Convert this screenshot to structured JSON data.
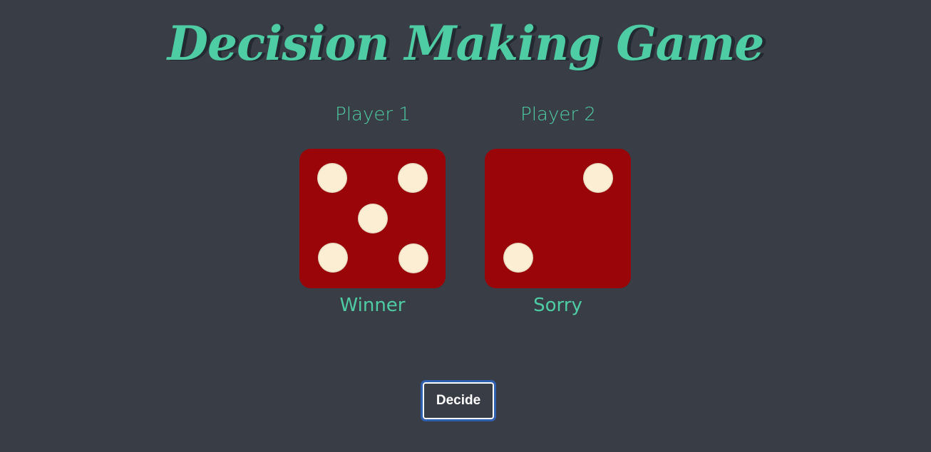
{
  "title": "Decision Making Game",
  "players": [
    {
      "name": "Player 1",
      "die_value": 5,
      "result": "Winner"
    },
    {
      "name": "Player 2",
      "die_value": 2,
      "result": "Sorry"
    }
  ],
  "decide_button": "Decide",
  "colors": {
    "background": "#393e46",
    "accent": "#4ecca3",
    "die": "#990508",
    "pip": "#fbeed2",
    "button_focus": "#2f5fb0"
  }
}
